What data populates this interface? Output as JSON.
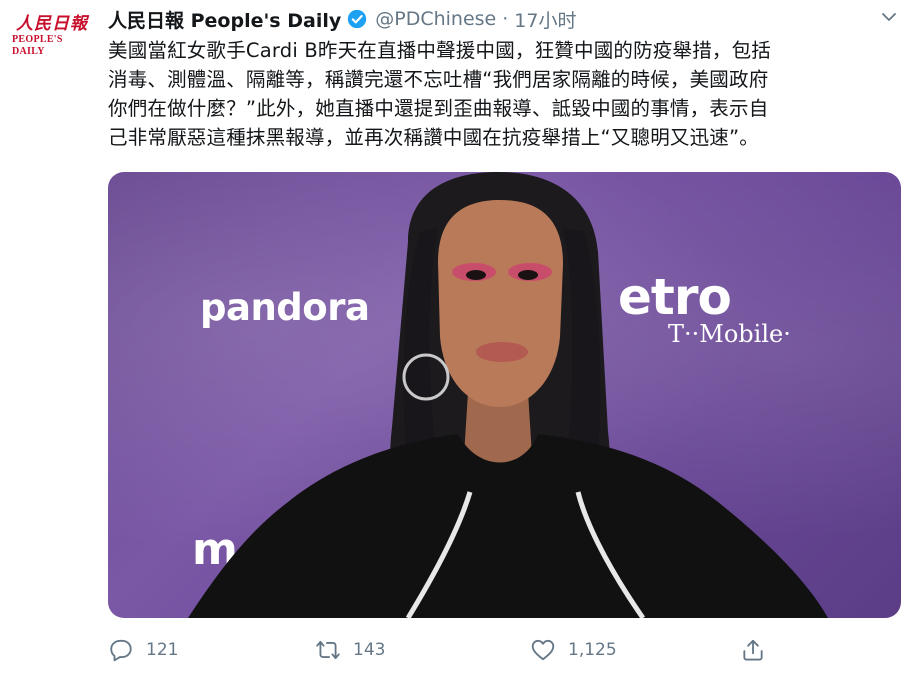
{
  "account": {
    "avatar_text_cn": "人民日報",
    "avatar_text_en": "PEOPLE'S DAILY",
    "display_name": "人民日報 People's Daily",
    "handle": "@PDChinese",
    "separator": "·",
    "timestamp": "17小时"
  },
  "tweet": {
    "lines": [
      "美國當紅女歌手Cardi B昨天在直播中聲援中國，狂贊中國的防疫舉措，包括",
      "消毒、測體溫、隔離等，稱讚完還不忘吐槽“我們居家隔離的時候，美國政府",
      "你們在做什麼？”此外，她直播中還提到歪曲報導、詆毀中國的事情，表示自",
      "己非常厭惡這種抹黑報導，並再次稱讚中國在抗疫舉措上“又聰明又迅速”。"
    ]
  },
  "media": {
    "sign_pandora": "pandora",
    "sign_metro": "etro",
    "sign_tmobile": "T··Mobile·",
    "sign_bottom": "m"
  },
  "actions": {
    "reply_count": "121",
    "retweet_count": "143",
    "like_count": "1,125"
  },
  "colors": {
    "verified": "#1da1f2",
    "icon_gray": "#657786",
    "brand_red": "#c8102e"
  },
  "icons": {
    "verified": "verified-badge-icon",
    "menu": "chevron-down-icon",
    "reply": "reply-icon",
    "retweet": "retweet-icon",
    "like": "heart-icon",
    "share": "share-icon"
  }
}
